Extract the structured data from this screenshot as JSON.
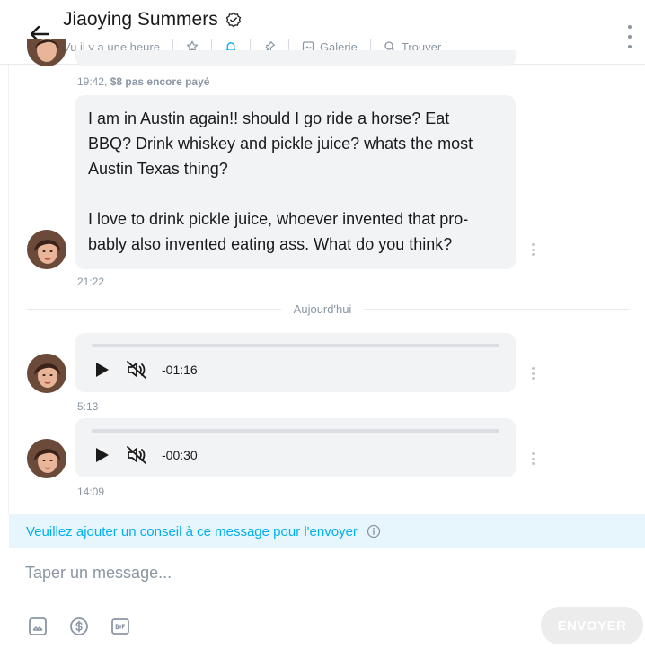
{
  "header": {
    "title": "Jiaoying Summers",
    "last_seen": "Vu il y a une heure",
    "gallery_label": "Galerie",
    "find_label": "Trouver",
    "icons": [
      "back-arrow-icon",
      "verified-icon",
      "star-icon",
      "bell-icon",
      "pin-icon",
      "gallery-icon",
      "search-icon",
      "more-icon"
    ]
  },
  "messages": [
    {
      "type": "text",
      "meta_time": "19:42,",
      "meta_status": "$8 pas encore payé"
    },
    {
      "type": "text",
      "paragraphs": [
        "I am in Austin again!! should I go ride a horse? Eat BBQ? Drink whiskey and pickle juice? whats the most Austin Texas thing?",
        "I love to drink pickle juice, whoever invented that pro-bably also invented eating ass. What do you think?"
      ],
      "lines_p1": [
        "I am in Austin again!! should I go ride a horse? Eat",
        "BBQ? Drink whiskey and pickle juice? whats the most",
        "Austin Texas thing?"
      ],
      "lines_p2": [
        "I love to drink pickle juice, whoever invented that pro-",
        "bably also invented eating ass. What do you think?"
      ],
      "time": "21:22"
    },
    {
      "type": "audio",
      "duration": "-01:16",
      "time": "5:13"
    },
    {
      "type": "audio",
      "duration": "-00:30",
      "time": "14:09"
    }
  ],
  "divider_label": "Aujourd'hui",
  "tip_banner": "Veuillez ajouter un conseil à ce message pour l'envoyer",
  "composer": {
    "placeholder": "Taper un message...",
    "send_label": "ENVOYER",
    "tools": [
      "image-icon",
      "dollar-icon",
      "gif-icon"
    ]
  },
  "colors": {
    "accent": "#00aff0",
    "bubble": "#f2f3f5",
    "muted": "#8a96a3",
    "banner_bg": "#e7f6fc"
  }
}
